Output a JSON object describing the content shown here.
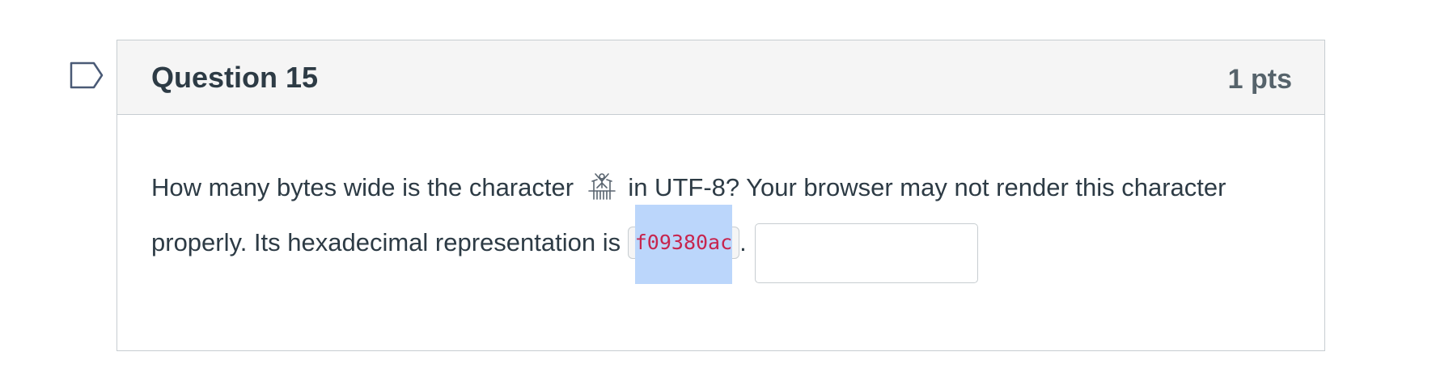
{
  "question": {
    "title": "Question 15",
    "points": "1 pts",
    "text_part1": "How many bytes wide is the character",
    "character_icon": "ceremonial-pole-glyph-icon",
    "text_part2": "in UTF-8? Your browser may not render this character",
    "text_part3": "properly. Its hexadecimal representation is",
    "hex_code": "f09380ac",
    "text_part4": ".",
    "answer": {
      "value": "",
      "placeholder": ""
    }
  },
  "flag_icon": "bookmark-flag-icon",
  "colors": {
    "header_bg": "#f5f5f5",
    "border": "#c7cdd1",
    "text": "#2d3b45",
    "code_text": "#c7254e",
    "selection": "#bbd6fb",
    "flag_stroke": "#4a5a76"
  }
}
